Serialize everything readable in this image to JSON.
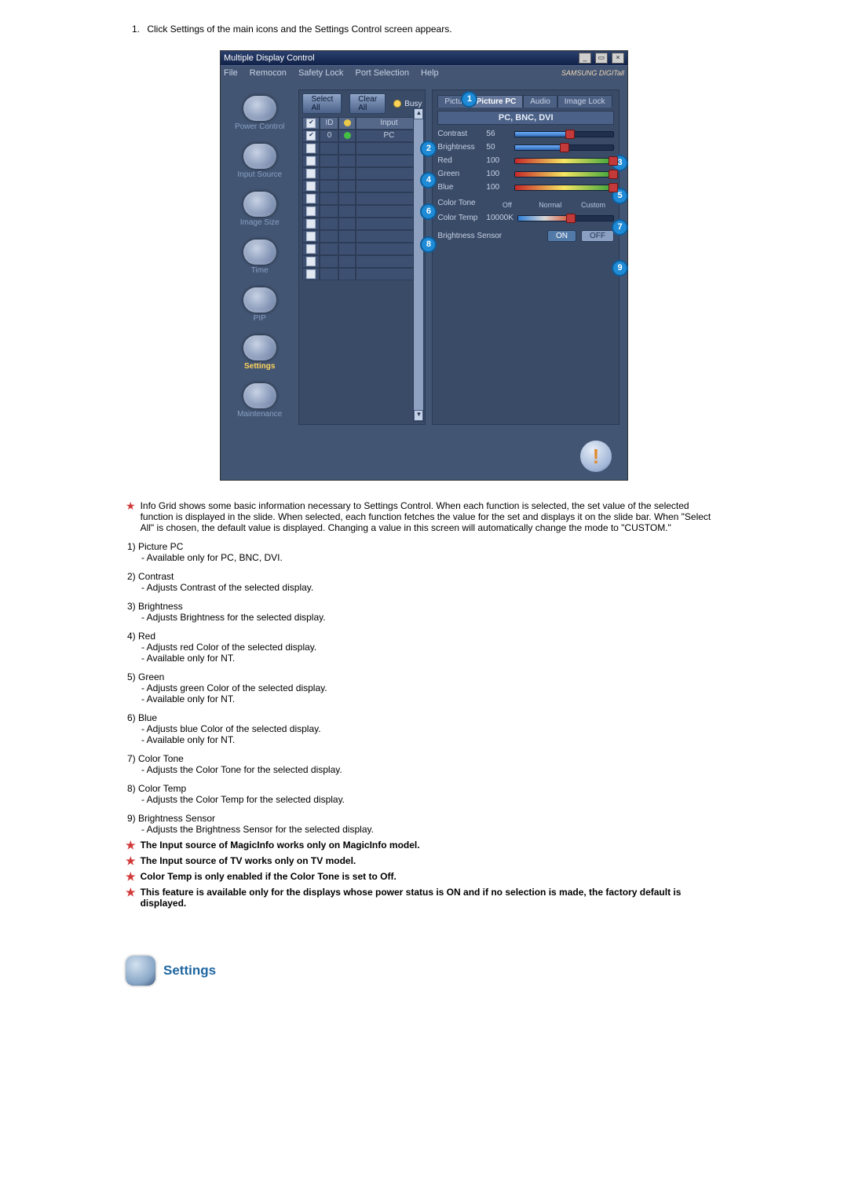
{
  "intro_step_num": "1.",
  "intro_step_text": "Click Settings of the main icons and the Settings Control screen appears.",
  "app": {
    "title": "Multiple Display Control",
    "menu": [
      "File",
      "Remocon",
      "Safety Lock",
      "Port Selection",
      "Help"
    ],
    "brand": "SAMSUNG DIGITall",
    "sidebar": [
      {
        "label": "Power Control"
      },
      {
        "label": "Input Source"
      },
      {
        "label": "Image Size"
      },
      {
        "label": "Time"
      },
      {
        "label": "PIP"
      },
      {
        "label": "Settings",
        "selected": true
      },
      {
        "label": "Maintenance"
      }
    ],
    "select_all": "Select All",
    "clear_all": "Clear All",
    "busy": "Busy",
    "grid_head": {
      "id": "ID",
      "input": "Input"
    },
    "grid_first": {
      "id": "0",
      "input": "PC"
    },
    "tabs": [
      "Pictu",
      "Picture PC",
      "Audio",
      "Image Lock"
    ],
    "status": "PC, BNC, DVI",
    "rows": {
      "contrast": {
        "label": "Contrast",
        "value": "56",
        "pct": 56
      },
      "brightness": {
        "label": "Brightness",
        "value": "50",
        "pct": 50
      },
      "red": {
        "label": "Red",
        "value": "100",
        "pct": 100
      },
      "green": {
        "label": "Green",
        "value": "100",
        "pct": 100
      },
      "blue": {
        "label": "Blue",
        "value": "100",
        "pct": 100
      },
      "colortone": {
        "label": "Color Tone",
        "opts": [
          "Off",
          "Normal",
          "Custom"
        ]
      },
      "colortemp": {
        "label": "Color Temp",
        "value": "10000K",
        "pct": 55
      },
      "bsensor": {
        "label": "Brightness Sensor",
        "on": "ON",
        "off": "OFF"
      }
    },
    "callouts": {
      "1": "1",
      "2": "2",
      "3": "3",
      "4": "4",
      "5": "5",
      "6": "6",
      "7": "7",
      "8": "8",
      "9": "9"
    }
  },
  "star_intro": "Info Grid shows some basic information necessary to Settings Control. When each function is selected, the set value of the selected function is displayed in the slide. When selected, each function fetches the value for the set and displays it on the slide bar. When \"Select All\" is chosen, the default value is displayed. Changing a value in this screen will automatically change the mode to \"CUSTOM.\"",
  "defs": [
    {
      "n": "1)",
      "title": "Picture PC",
      "subs": [
        "- Available only for PC, BNC, DVI."
      ]
    },
    {
      "n": "2)",
      "title": "Contrast",
      "subs": [
        "- Adjusts Contrast of the selected display."
      ]
    },
    {
      "n": "3)",
      "title": "Brightness",
      "subs": [
        "- Adjusts Brightness for the selected display."
      ]
    },
    {
      "n": "4)",
      "title": "Red",
      "subs": [
        "- Adjusts red Color of the selected display.",
        "- Available  only for NT."
      ]
    },
    {
      "n": "5)",
      "title": "Green",
      "subs": [
        "- Adjusts green Color of the selected display.",
        "- Available  only for NT."
      ]
    },
    {
      "n": "6)",
      "title": "Blue",
      "subs": [
        "- Adjusts blue Color of the selected display.",
        "- Available  only for NT."
      ]
    },
    {
      "n": "7)",
      "title": "Color Tone",
      "subs": [
        "- Adjusts the Color Tone for the selected display."
      ]
    },
    {
      "n": "8)",
      "title": "Color Temp",
      "subs": [
        "- Adjusts the Color Temp for the selected display."
      ]
    },
    {
      "n": "9)",
      "title": "Brightness Sensor",
      "subs": [
        "- Adjusts the Brightness Sensor for the selected display."
      ]
    }
  ],
  "star_notes": [
    "The Input source of MagicInfo works only on MagicInfo model.",
    "The Input source of TV works only on TV model.",
    "Color Temp is only enabled if the Color Tone is set to Off.",
    "This feature is available only for the displays whose power status is ON and if no selection is made, the factory default is displayed."
  ],
  "section_heading": "Settings"
}
